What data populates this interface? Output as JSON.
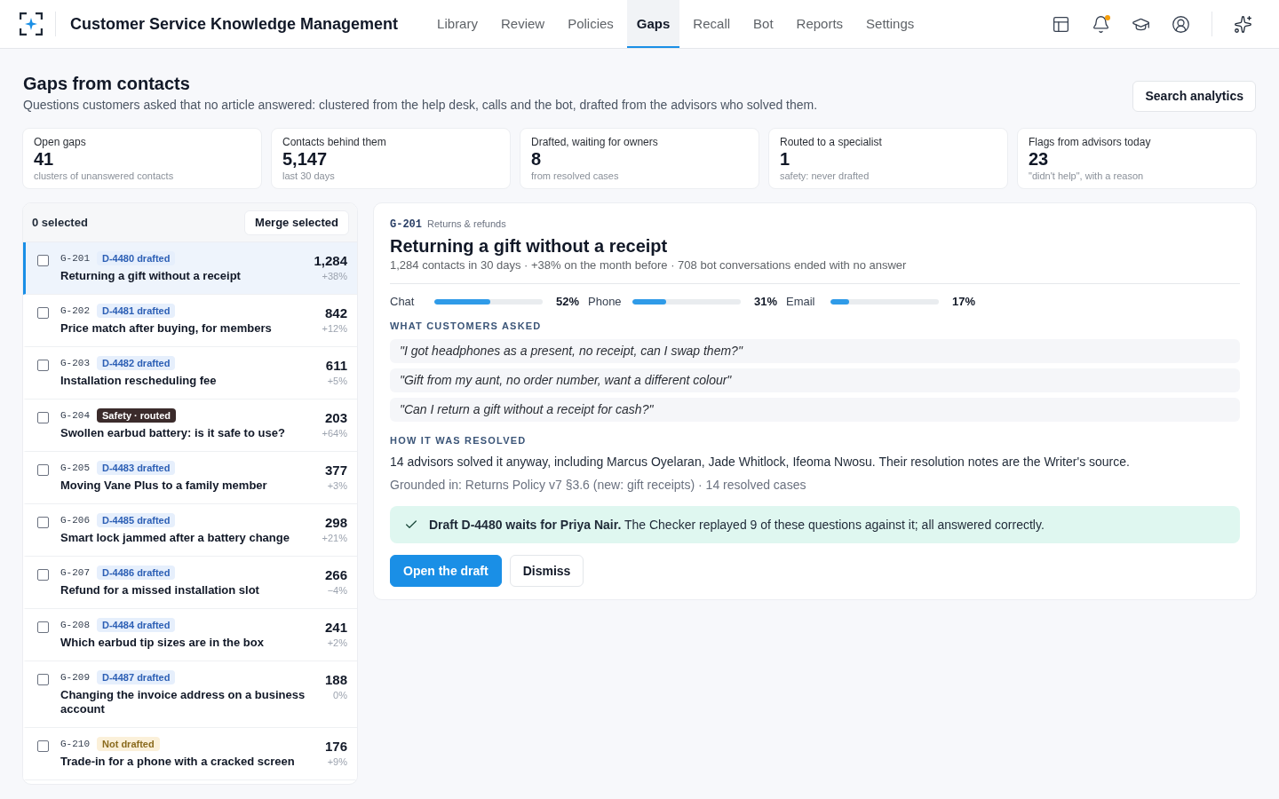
{
  "header": {
    "title": "Customer Service Knowledge Management",
    "nav": [
      {
        "label": "Library",
        "selected": false
      },
      {
        "label": "Review",
        "selected": false
      },
      {
        "label": "Policies",
        "selected": false
      },
      {
        "label": "Gaps",
        "selected": true
      },
      {
        "label": "Recall",
        "selected": false
      },
      {
        "label": "Bot",
        "selected": false
      },
      {
        "label": "Reports",
        "selected": false
      },
      {
        "label": "Settings",
        "selected": false
      }
    ],
    "notifications_unread": true
  },
  "page": {
    "title": "Gaps from contacts",
    "subtitle": "Questions customers asked that no article answered: clustered from the help desk, calls and the bot, drafted from the advisors who solved them.",
    "search_button": "Search analytics"
  },
  "stats": [
    {
      "label": "Open gaps",
      "value": "41",
      "note": "clusters of unanswered contacts"
    },
    {
      "label": "Contacts behind them",
      "value": "5,147",
      "note": "last 30 days"
    },
    {
      "label": "Drafted, waiting for owners",
      "value": "8",
      "note": "from resolved cases"
    },
    {
      "label": "Routed to a specialist",
      "value": "1",
      "note": "safety: never drafted"
    },
    {
      "label": "Flags from advisors today",
      "value": "23",
      "note": "\"didn't help\", with a reason"
    }
  ],
  "gap_list": {
    "selected_count": "0 selected",
    "merge_button": "Merge selected",
    "items": [
      {
        "id": "G-201",
        "tag": {
          "text": "D-4480 drafted",
          "kind": "info"
        },
        "title": "Returning a gift without a receipt",
        "count": "1,284",
        "change": "+38%",
        "selected": true,
        "checked": false
      },
      {
        "id": "G-202",
        "tag": {
          "text": "D-4481 drafted",
          "kind": "info"
        },
        "title": "Price match after buying, for members",
        "count": "842",
        "change": "+12%",
        "selected": false,
        "checked": false
      },
      {
        "id": "G-203",
        "tag": {
          "text": "D-4482 drafted",
          "kind": "info"
        },
        "title": "Installation rescheduling fee",
        "count": "611",
        "change": "+5%",
        "selected": false,
        "checked": false
      },
      {
        "id": "G-204",
        "tag": {
          "text": "Safety · routed",
          "kind": "danger"
        },
        "title": "Swollen earbud battery: is it safe to use?",
        "count": "203",
        "change": "+64%",
        "selected": false,
        "checked": false
      },
      {
        "id": "G-205",
        "tag": {
          "text": "D-4483 drafted",
          "kind": "info"
        },
        "title": "Moving Vane Plus to a family member",
        "count": "377",
        "change": "+3%",
        "selected": false,
        "checked": false
      },
      {
        "id": "G-206",
        "tag": {
          "text": "D-4485 drafted",
          "kind": "info"
        },
        "title": "Smart lock jammed after a battery change",
        "count": "298",
        "change": "+21%",
        "selected": false,
        "checked": false
      },
      {
        "id": "G-207",
        "tag": {
          "text": "D-4486 drafted",
          "kind": "info"
        },
        "title": "Refund for a missed installation slot",
        "count": "266",
        "change": "−4%",
        "selected": false,
        "checked": false
      },
      {
        "id": "G-208",
        "tag": {
          "text": "D-4484 drafted",
          "kind": "info"
        },
        "title": "Which earbud tip sizes are in the box",
        "count": "241",
        "change": "+2%",
        "selected": false,
        "checked": false
      },
      {
        "id": "G-209",
        "tag": {
          "text": "D-4487 drafted",
          "kind": "info"
        },
        "title": "Changing the invoice address on a business account",
        "count": "188",
        "change": "0%",
        "selected": false,
        "checked": false
      },
      {
        "id": "G-210",
        "tag": {
          "text": "Not drafted",
          "kind": "warning"
        },
        "title": "Trade-in for a phone with a cracked screen",
        "count": "176",
        "change": "+9%",
        "selected": false,
        "checked": false
      }
    ]
  },
  "detail": {
    "id": "G-201",
    "category": "Returns & refunds",
    "title": "Returning a gift without a receipt",
    "summary": "1,284 contacts in 30 days · +38% on the month before · 708 bot conversations ended with no answer",
    "channels": [
      {
        "name": "Chat",
        "level": 0.52,
        "reading": "52%"
      },
      {
        "name": "Phone",
        "level": 0.31,
        "reading": "31%"
      },
      {
        "name": "Email",
        "level": 0.17,
        "reading": "17%"
      }
    ],
    "asked_heading": "WHAT CUSTOMERS ASKED",
    "quotes": [
      "\"I got headphones as a present, no receipt, can I swap them?\"",
      "\"Gift from my aunt, no order number, want a different colour\"",
      "\"Can I return a gift without a receipt for cash?\""
    ],
    "resolved_heading": "HOW IT WAS RESOLVED",
    "resolution": "14 advisors solved it anyway, including Marcus Oyelaran, Jade Whitlock, Ifeoma Nwosu. Their resolution notes are the Writer's source.",
    "grounding": "Grounded in: Returns Policy v7 §3.6 (new: gift receipts) · 14 resolved cases",
    "callout": "**Draft D-4480 waits for Priya Nair.** The Checker replayed 9 of these questions against it; all answered correctly.",
    "buttons": [
      {
        "label": "Open the draft",
        "kind": "primary"
      },
      {
        "label": "Dismiss",
        "kind": "secondary"
      }
    ]
  }
}
